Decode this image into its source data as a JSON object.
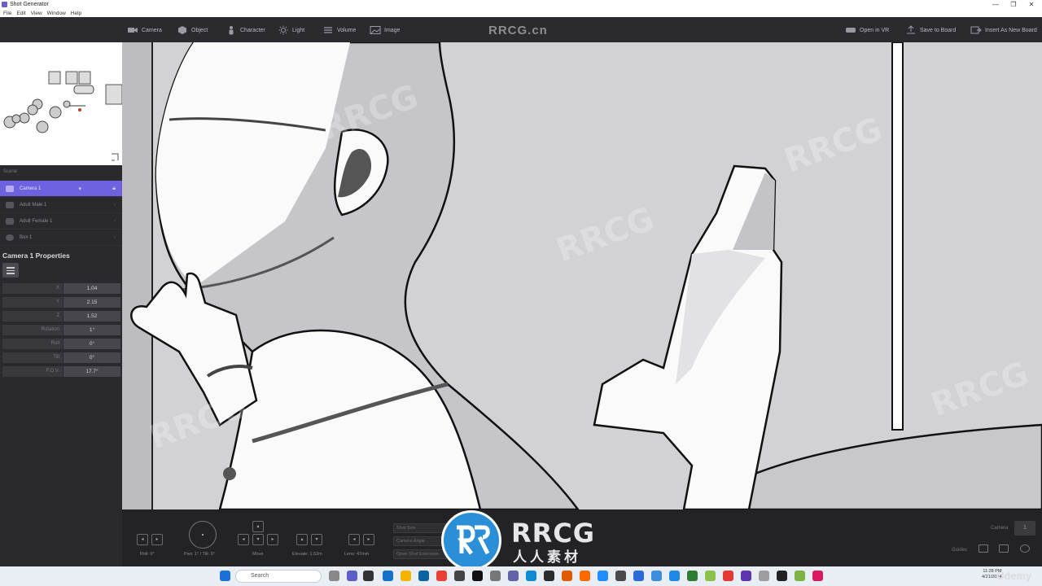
{
  "window": {
    "title": "Shot Generator",
    "controls": [
      "—",
      "❐",
      "✕"
    ]
  },
  "menu": [
    "File",
    "Edit",
    "View",
    "Window",
    "Help"
  ],
  "toolbar": {
    "items": [
      {
        "label": "Camera",
        "icon": "camera-icon"
      },
      {
        "label": "Object",
        "icon": "cube-icon"
      },
      {
        "label": "Character",
        "icon": "person-icon"
      },
      {
        "label": "Light",
        "icon": "sun-icon"
      },
      {
        "label": "Volume",
        "icon": "volume-icon"
      },
      {
        "label": "Image",
        "icon": "image-icon"
      }
    ],
    "right_items": [
      {
        "label": "Open in VR",
        "icon": "vr-icon"
      },
      {
        "label": "Save to Board",
        "icon": "upload-icon"
      },
      {
        "label": "Insert As New Board",
        "icon": "insert-board-icon"
      }
    ]
  },
  "watermark": "RRCG.cn",
  "scene": {
    "label": "Scene",
    "items": [
      {
        "label": "Camera 1",
        "active": true
      },
      {
        "label": "Adult Male 1",
        "active": false
      },
      {
        "label": "Adult Female 1",
        "active": false
      },
      {
        "label": "Box 1",
        "active": false
      }
    ]
  },
  "properties": {
    "title": "Camera 1 Properties",
    "rows": [
      {
        "label": "X",
        "value": "1.04"
      },
      {
        "label": "Y",
        "value": "2.15"
      },
      {
        "label": "Z",
        "value": "1.52"
      },
      {
        "label": "Rotation",
        "value": "1°"
      },
      {
        "label": "Roll",
        "value": "0°"
      },
      {
        "label": "Tilt",
        "value": "0°"
      },
      {
        "label": "F.O.V.",
        "value": "17.7°"
      }
    ]
  },
  "controls": {
    "roll": "Roll: 0°",
    "pan": "Pan: 1° / Tilt: 0°",
    "move": "Move",
    "elevate": "Elevate: 1.52m",
    "lens": "Lens: 47mm",
    "shot_size": "Shot Size",
    "camera_angle": "Camera Angle",
    "extension": "Open Shot Extension",
    "camera_label": "Camera",
    "camera_value": "1",
    "guides_label": "Guides"
  },
  "logo": {
    "text": "RRCG",
    "cn": "人人素材"
  },
  "taskbar": {
    "search": "Search",
    "time": "11:28 PM",
    "date": "4/21/2024",
    "udemy": "Udemy"
  }
}
